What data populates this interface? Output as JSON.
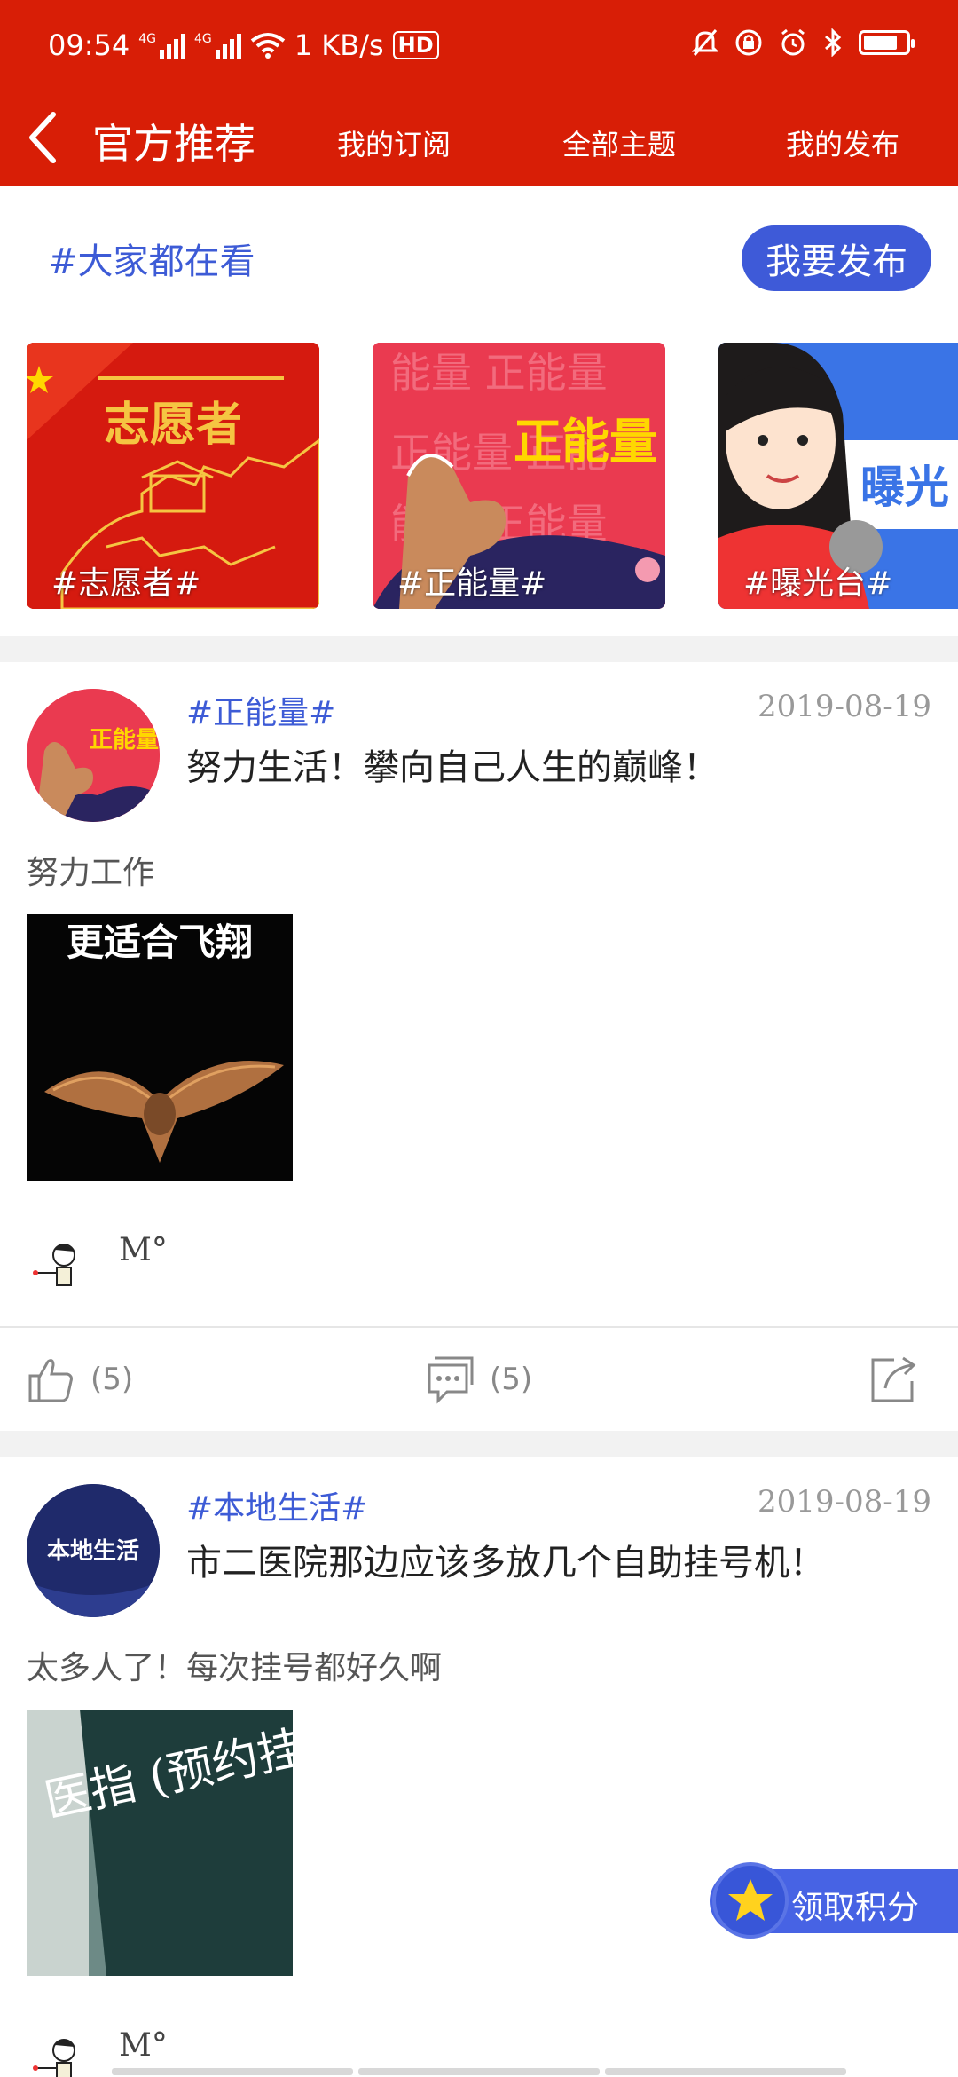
{
  "status_bar": {
    "time": "09:54",
    "net1": "4G",
    "net2": "4G",
    "speed": "1 KB/s",
    "hd": "HD",
    "battery_level": 0.8
  },
  "nav": {
    "title": "官方推荐",
    "tabs": [
      "我的订阅",
      "全部主题",
      "我的发布"
    ]
  },
  "header": {
    "hashtag": "#大家都在看",
    "publish_label": "我要发布"
  },
  "topics": [
    {
      "label": "#志愿者#",
      "art_text": "志愿者"
    },
    {
      "label": "#正能量#",
      "art_text": "正能量"
    },
    {
      "label": "#曝光台#",
      "art_text": "曝光"
    }
  ],
  "posts": [
    {
      "topic": "#正能量#",
      "date": "2019-08-19",
      "title": "努力生活！攀向自己人生的巅峰！",
      "body": "努力工作",
      "image_text": "更适合飞翔",
      "avatar_text": "正能量",
      "author": "M°",
      "likes": "(5)",
      "comments": "(5)"
    },
    {
      "topic": "#本地生活#",
      "date": "2019-08-19",
      "title": "市二医院那边应该多放几个自助挂号机！",
      "body": "太多人了！每次挂号都好久啊",
      "image_text": "医指 (预约挂",
      "avatar_text": "本地生活",
      "author": "M°"
    }
  ],
  "points_label": "领取积分",
  "colors": {
    "primary_red": "#d81e06",
    "accent_blue": "#3e5ad8"
  }
}
